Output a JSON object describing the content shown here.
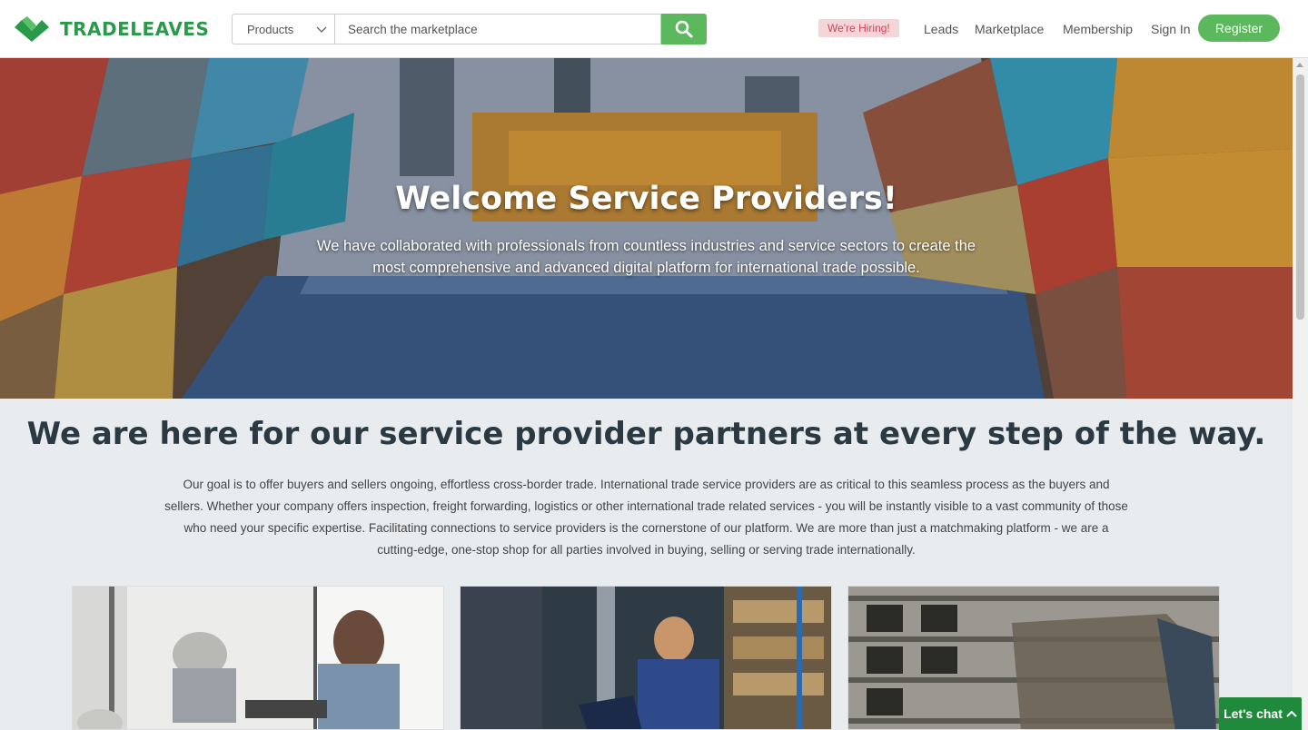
{
  "brand": {
    "name": "TRADELEAVES",
    "color": "#2a9a4a"
  },
  "search": {
    "category": "Products",
    "placeholder": "Search the marketplace",
    "button_icon": "search-icon"
  },
  "nav": {
    "hiring_badge": "We're Hiring!",
    "links": [
      "Leads",
      "Marketplace",
      "Membership",
      "Sign In"
    ],
    "register": "Register"
  },
  "hero": {
    "title": "Welcome Service Providers!",
    "subtitle": "We have collaborated with professionals from countless industries and service sectors to create the most comprehensive and advanced digital platform for international trade possible."
  },
  "section": {
    "title": "We are here for our service provider partners at every step of the way.",
    "body": "Our goal is to offer buyers and sellers ongoing, effortless cross-border trade. International trade service providers are as critical to this seamless process as the buyers and sellers. Whether your company offers inspection, freight forwarding, logistics or other international trade related services - you will be instantly visible to a vast community of those who need your specific expertise. Facilitating connections to service providers is the cornerstone of our platform. We are more than just a matchmaking platform - we are a cutting-edge, one-stop shop for all parties involved in buying, selling or serving trade internationally."
  },
  "chat": {
    "label": "Let's chat"
  },
  "colors": {
    "accent": "#5cb85c",
    "chat": "#1f8a3c",
    "hiring_bg": "#f6d5d8",
    "hiring_text": "#c9445a"
  }
}
